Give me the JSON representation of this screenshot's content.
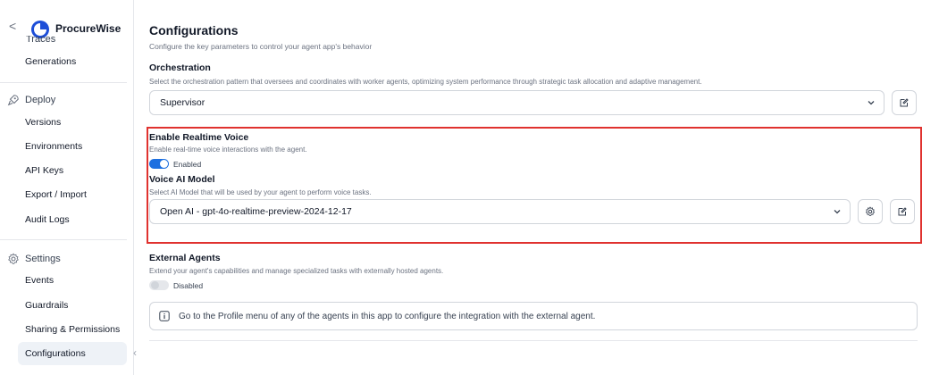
{
  "sidebar": {
    "back_glyph": "<",
    "brand": "ProcureWise",
    "traces_label": "Traces",
    "generations_label": "Generations",
    "deploy": {
      "label": "Deploy",
      "items": [
        "Versions",
        "Environments",
        "API Keys",
        "Export / Import",
        "Audit Logs"
      ]
    },
    "settings": {
      "label": "Settings",
      "items": [
        "Events",
        "Guardrails",
        "Sharing & Permissions",
        "Configurations"
      ],
      "active": "Configurations"
    },
    "collapse_glyph": "‹"
  },
  "page": {
    "title": "Configurations",
    "subtitle": "Configure the key parameters to control your agent app's behavior"
  },
  "orchestration": {
    "label": "Orchestration",
    "description": "Select the orchestration pattern that oversees and coordinates with worker agents, optimizing system performance through strategic task allocation and adaptive management.",
    "value": "Supervisor"
  },
  "realtime_voice": {
    "label": "Enable Realtime Voice",
    "description": "Enable real-time voice interactions with the agent.",
    "toggle_state": "Enabled",
    "model_label": "Voice AI Model",
    "model_description": "Select AI Model that will be used by your agent to perform voice tasks.",
    "model_value": "Open AI - gpt-4o-realtime-preview-2024-12-17"
  },
  "external_agents": {
    "label": "External Agents",
    "description": "Extend your agent's capabilities and manage specialized tasks with externally hosted agents.",
    "toggle_state": "Disabled",
    "info": "Go to the Profile menu of any of the agents in this app to configure the integration with the external agent."
  },
  "colors": {
    "accent": "#1d6fe0",
    "highlight": "#e0322f",
    "toggle_off": "#d1d5db"
  },
  "icons": {
    "deploy": "rocket-icon",
    "settings": "gear-icon",
    "dropdown": "chevron-down-icon",
    "edit": "edit-icon",
    "model_settings": "gear-icon",
    "info": "info-icon"
  }
}
